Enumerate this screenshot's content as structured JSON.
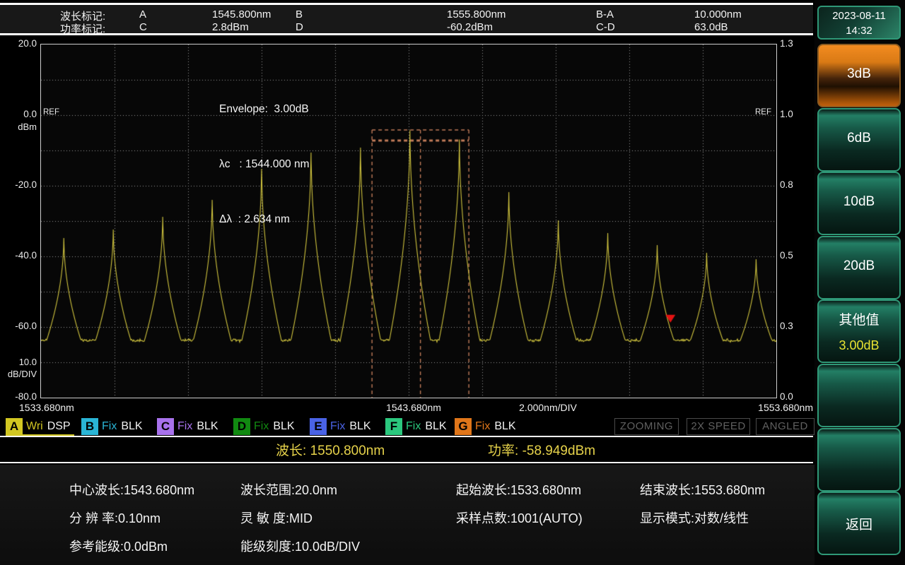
{
  "header": {
    "row1": {
      "label": "波长标记:",
      "m1": "A",
      "v1": "1545.800nm",
      "m2": "B",
      "v2": "1555.800nm",
      "diff": "B-A",
      "dv": "10.000nm"
    },
    "row2": {
      "label": "功率标记:",
      "m1": "C",
      "v1": "2.8dBm",
      "m2": "D",
      "v2": "-60.2dBm",
      "diff": "C-D",
      "dv": "63.0dB"
    }
  },
  "sidebar": {
    "date": "2023-08-11",
    "time": "14:32",
    "buttons": [
      {
        "name": "3db",
        "label": "3dB",
        "active": true
      },
      {
        "name": "6db",
        "label": "6dB"
      },
      {
        "name": "10db",
        "label": "10dB"
      },
      {
        "name": "20db",
        "label": "20dB"
      },
      {
        "name": "other-value",
        "label": "其他值",
        "sub": "3.00dB"
      },
      {
        "name": "blank-1",
        "label": ""
      },
      {
        "name": "blank-2",
        "label": ""
      },
      {
        "name": "back",
        "label": "返回"
      }
    ]
  },
  "annotation": {
    "line1": "Envelope:  3.00dB",
    "line2": "λc   : 1544.000 nm",
    "line3": "Δλ  : 2.634 nm"
  },
  "chart_data": {
    "type": "line",
    "title": "optical spectrum",
    "x_range_nm": [
      1533.68,
      1553.68
    ],
    "x_div_nm": 2.0,
    "y_left_range_dbm": [
      -80.0,
      20.0
    ],
    "y_div_db": 10.0,
    "y_tick_dbm": [
      20,
      0,
      -20,
      -40,
      -60,
      -80
    ],
    "y_left_ticks": [
      "20.0",
      "0.0",
      "-20.0",
      "-40.0",
      "-60.0",
      "-80.0"
    ],
    "y_right_ticks": [
      "1.3",
      "1.0",
      "0.8",
      "0.5",
      "0.3",
      "0.0"
    ],
    "y_left_unit": "dBm",
    "y_scale_value": "10.0",
    "y_scale_unit": "dB/DIV",
    "ref_label": "REF",
    "ref_level_dbm": 0.0,
    "x_ticks": {
      "left": "1533.680nm",
      "center": "1543.680nm",
      "div": "2.000nm/DIV",
      "right": "1553.680nm"
    },
    "noise_floor_dbm": -63.8,
    "trace_color": "#d0c43e",
    "grid_color": "#9a9a9a",
    "peaks": [
      {
        "nm": 1534.3,
        "dbm": -34.8
      },
      {
        "nm": 1535.645,
        "dbm": -32.4
      },
      {
        "nm": 1536.99,
        "dbm": -28.8
      },
      {
        "nm": 1538.335,
        "dbm": -24.0
      },
      {
        "nm": 1539.68,
        "dbm": -15.2
      },
      {
        "nm": 1541.025,
        "dbm": -10.6
      },
      {
        "nm": 1542.37,
        "dbm": -9.2
      },
      {
        "nm": 1543.715,
        "dbm": -4.3
      },
      {
        "nm": 1545.06,
        "dbm": -6.9
      },
      {
        "nm": 1546.405,
        "dbm": -21.8
      },
      {
        "nm": 1547.75,
        "dbm": -29.8
      },
      {
        "nm": 1549.095,
        "dbm": -33.4
      },
      {
        "nm": 1550.44,
        "dbm": -36.8
      },
      {
        "nm": 1551.785,
        "dbm": -39.0
      },
      {
        "nm": 1553.13,
        "dbm": -40.8
      }
    ],
    "marker": {
      "nm": 1550.8,
      "dbm": -58.949,
      "color": "#e41212"
    },
    "envelope": {
      "left_nm": 1542.683,
      "right_nm": 1545.317,
      "center_nm": 1544.0,
      "top_dbm": -4.2,
      "cut_dbm": -7.2,
      "color": "#bf7a58"
    }
  },
  "traces": [
    {
      "letter": "A",
      "mode": "Wri",
      "type": "DSP",
      "color": "#d2c722",
      "active": true
    },
    {
      "letter": "B",
      "mode": "Fix",
      "type": "BLK",
      "color": "#2ab5d6"
    },
    {
      "letter": "C",
      "mode": "Fix",
      "type": "BLK",
      "color": "#a872ec"
    },
    {
      "letter": "D",
      "mode": "Fix",
      "type": "BLK",
      "color": "#118a11"
    },
    {
      "letter": "E",
      "mode": "Fix",
      "type": "BLK",
      "color": "#4a63e6"
    },
    {
      "letter": "F",
      "mode": "Fix",
      "type": "BLK",
      "color": "#2bc87e"
    },
    {
      "letter": "G",
      "mode": "Fix",
      "type": "BLK",
      "color": "#e0761a"
    }
  ],
  "status_flags": [
    "ZOOMING",
    "2X SPEED",
    "ANGLED"
  ],
  "readout": {
    "wl_label": "波长:",
    "wl_value": "1550.800nm",
    "pw_label": "功率:",
    "pw_value": "-58.949dBm"
  },
  "info_rows": [
    [
      "中心波长:1543.680nm",
      "波长范围:20.0nm",
      "起始波长:1533.680nm",
      "结束波长:1553.680nm"
    ],
    [
      "分 辨 率:0.10nm",
      "灵 敏 度:MID",
      "采样点数:1001(AUTO)",
      "显示模式:对数/线性"
    ],
    [
      "参考能级:0.0dBm",
      "能级刻度:10.0dB/DIV",
      "",
      ""
    ]
  ]
}
